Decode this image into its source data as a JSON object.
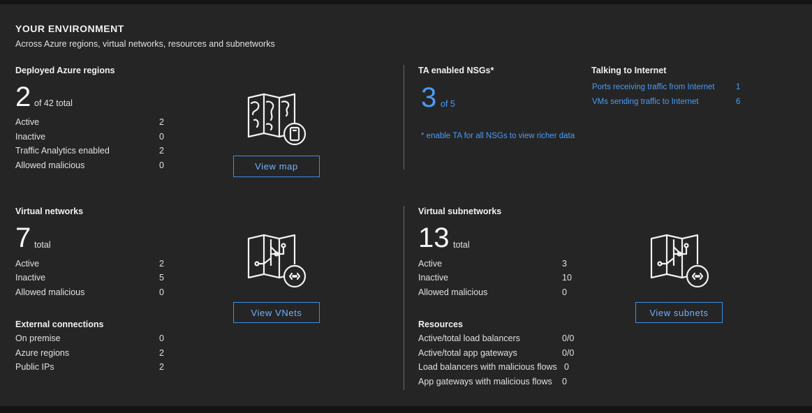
{
  "header": {
    "title": "YOUR ENVIRONMENT",
    "subtitle": "Across Azure regions, virtual networks, resources and subnetworks"
  },
  "regions": {
    "title": "Deployed Azure regions",
    "count": "2",
    "count_suffix": "of 42 total",
    "rows": [
      {
        "label": "Active",
        "value": "2"
      },
      {
        "label": "Inactive",
        "value": "0"
      },
      {
        "label": "Traffic Analytics enabled",
        "value": "2"
      },
      {
        "label": "Allowed malicious",
        "value": "0"
      }
    ],
    "button": "View map",
    "icon": "world-map-icon"
  },
  "nsgs": {
    "title": "TA enabled NSGs*",
    "count": "3",
    "count_suffix": "of 5",
    "note": "* enable TA for all NSGs to view richer data"
  },
  "internet": {
    "title": "Talking to Internet",
    "links": [
      {
        "label": "Ports receiving traffic from Internet",
        "value": "1"
      },
      {
        "label": "VMs sending traffic to Internet",
        "value": "6"
      }
    ]
  },
  "vnets": {
    "title": "Virtual networks",
    "count": "7",
    "count_suffix": "total",
    "rows": [
      {
        "label": "Active",
        "value": "2"
      },
      {
        "label": "Inactive",
        "value": "5"
      },
      {
        "label": "Allowed malicious",
        "value": "0"
      }
    ],
    "button": "View VNets",
    "icon": "network-map-icon"
  },
  "external": {
    "title": "External connections",
    "rows": [
      {
        "label": "On premise",
        "value": "0"
      },
      {
        "label": "Azure regions",
        "value": "2"
      },
      {
        "label": "Public IPs",
        "value": "2"
      }
    ]
  },
  "subnets": {
    "title": "Virtual subnetworks",
    "count": "13",
    "count_suffix": "total",
    "rows": [
      {
        "label": "Active",
        "value": "3"
      },
      {
        "label": "Inactive",
        "value": "10"
      },
      {
        "label": "Allowed malicious",
        "value": "0"
      }
    ],
    "button": "View subnets",
    "icon": "subnet-map-icon"
  },
  "resources": {
    "title": "Resources",
    "rows": [
      {
        "label": "Active/total load balancers",
        "value": "0/0"
      },
      {
        "label": "Active/total app gateways",
        "value": "0/0"
      },
      {
        "label": "Load balancers with malicious flows",
        "value": "0"
      },
      {
        "label": "App gateways with malicious flows",
        "value": "0"
      }
    ]
  },
  "colors": {
    "accent": "#4a9cf5",
    "background": "#252526"
  }
}
